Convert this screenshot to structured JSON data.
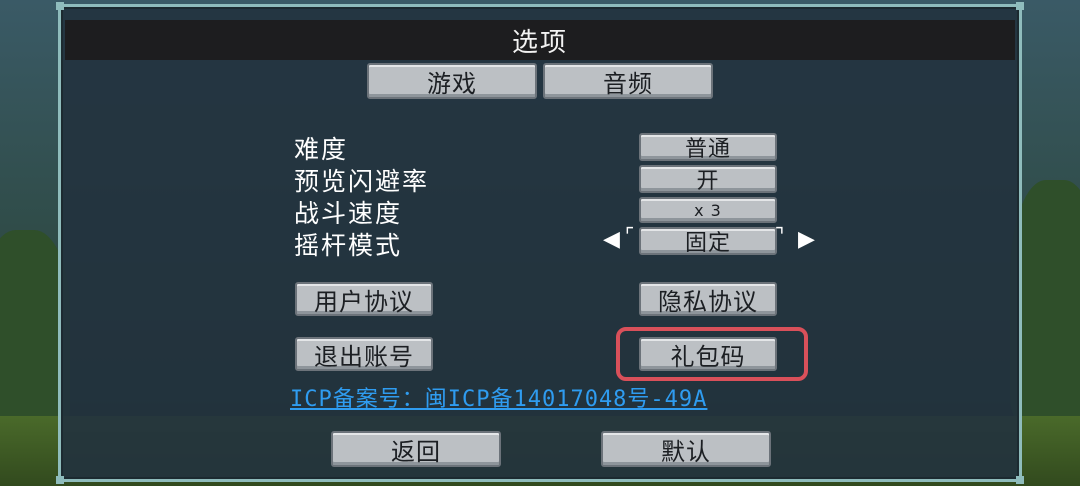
{
  "dialog": {
    "title": "选项"
  },
  "tabs": [
    {
      "label": "游戏"
    },
    {
      "label": "音频"
    }
  ],
  "settings": [
    {
      "label": "难度",
      "value": "普通"
    },
    {
      "label": "预览闪避率",
      "value": "开"
    },
    {
      "label": "战斗速度",
      "value": "x 3"
    },
    {
      "label": "摇杆模式",
      "value": "固定"
    }
  ],
  "buttons": {
    "user_agreement": "用户协议",
    "privacy_policy": "隐私协议",
    "logout": "退出账号",
    "gift_code": "礼包码",
    "back": "返回",
    "default": "默认"
  },
  "icp_text": "ICP备案号：闽ICP备14017048号-49A",
  "colors": {
    "highlight": "#d9505a",
    "link": "#2f9cf0",
    "frame": "#8fbcbc"
  },
  "icons": {
    "left_arrow": "arrow-left-icon",
    "right_arrow": "arrow-right-icon"
  }
}
